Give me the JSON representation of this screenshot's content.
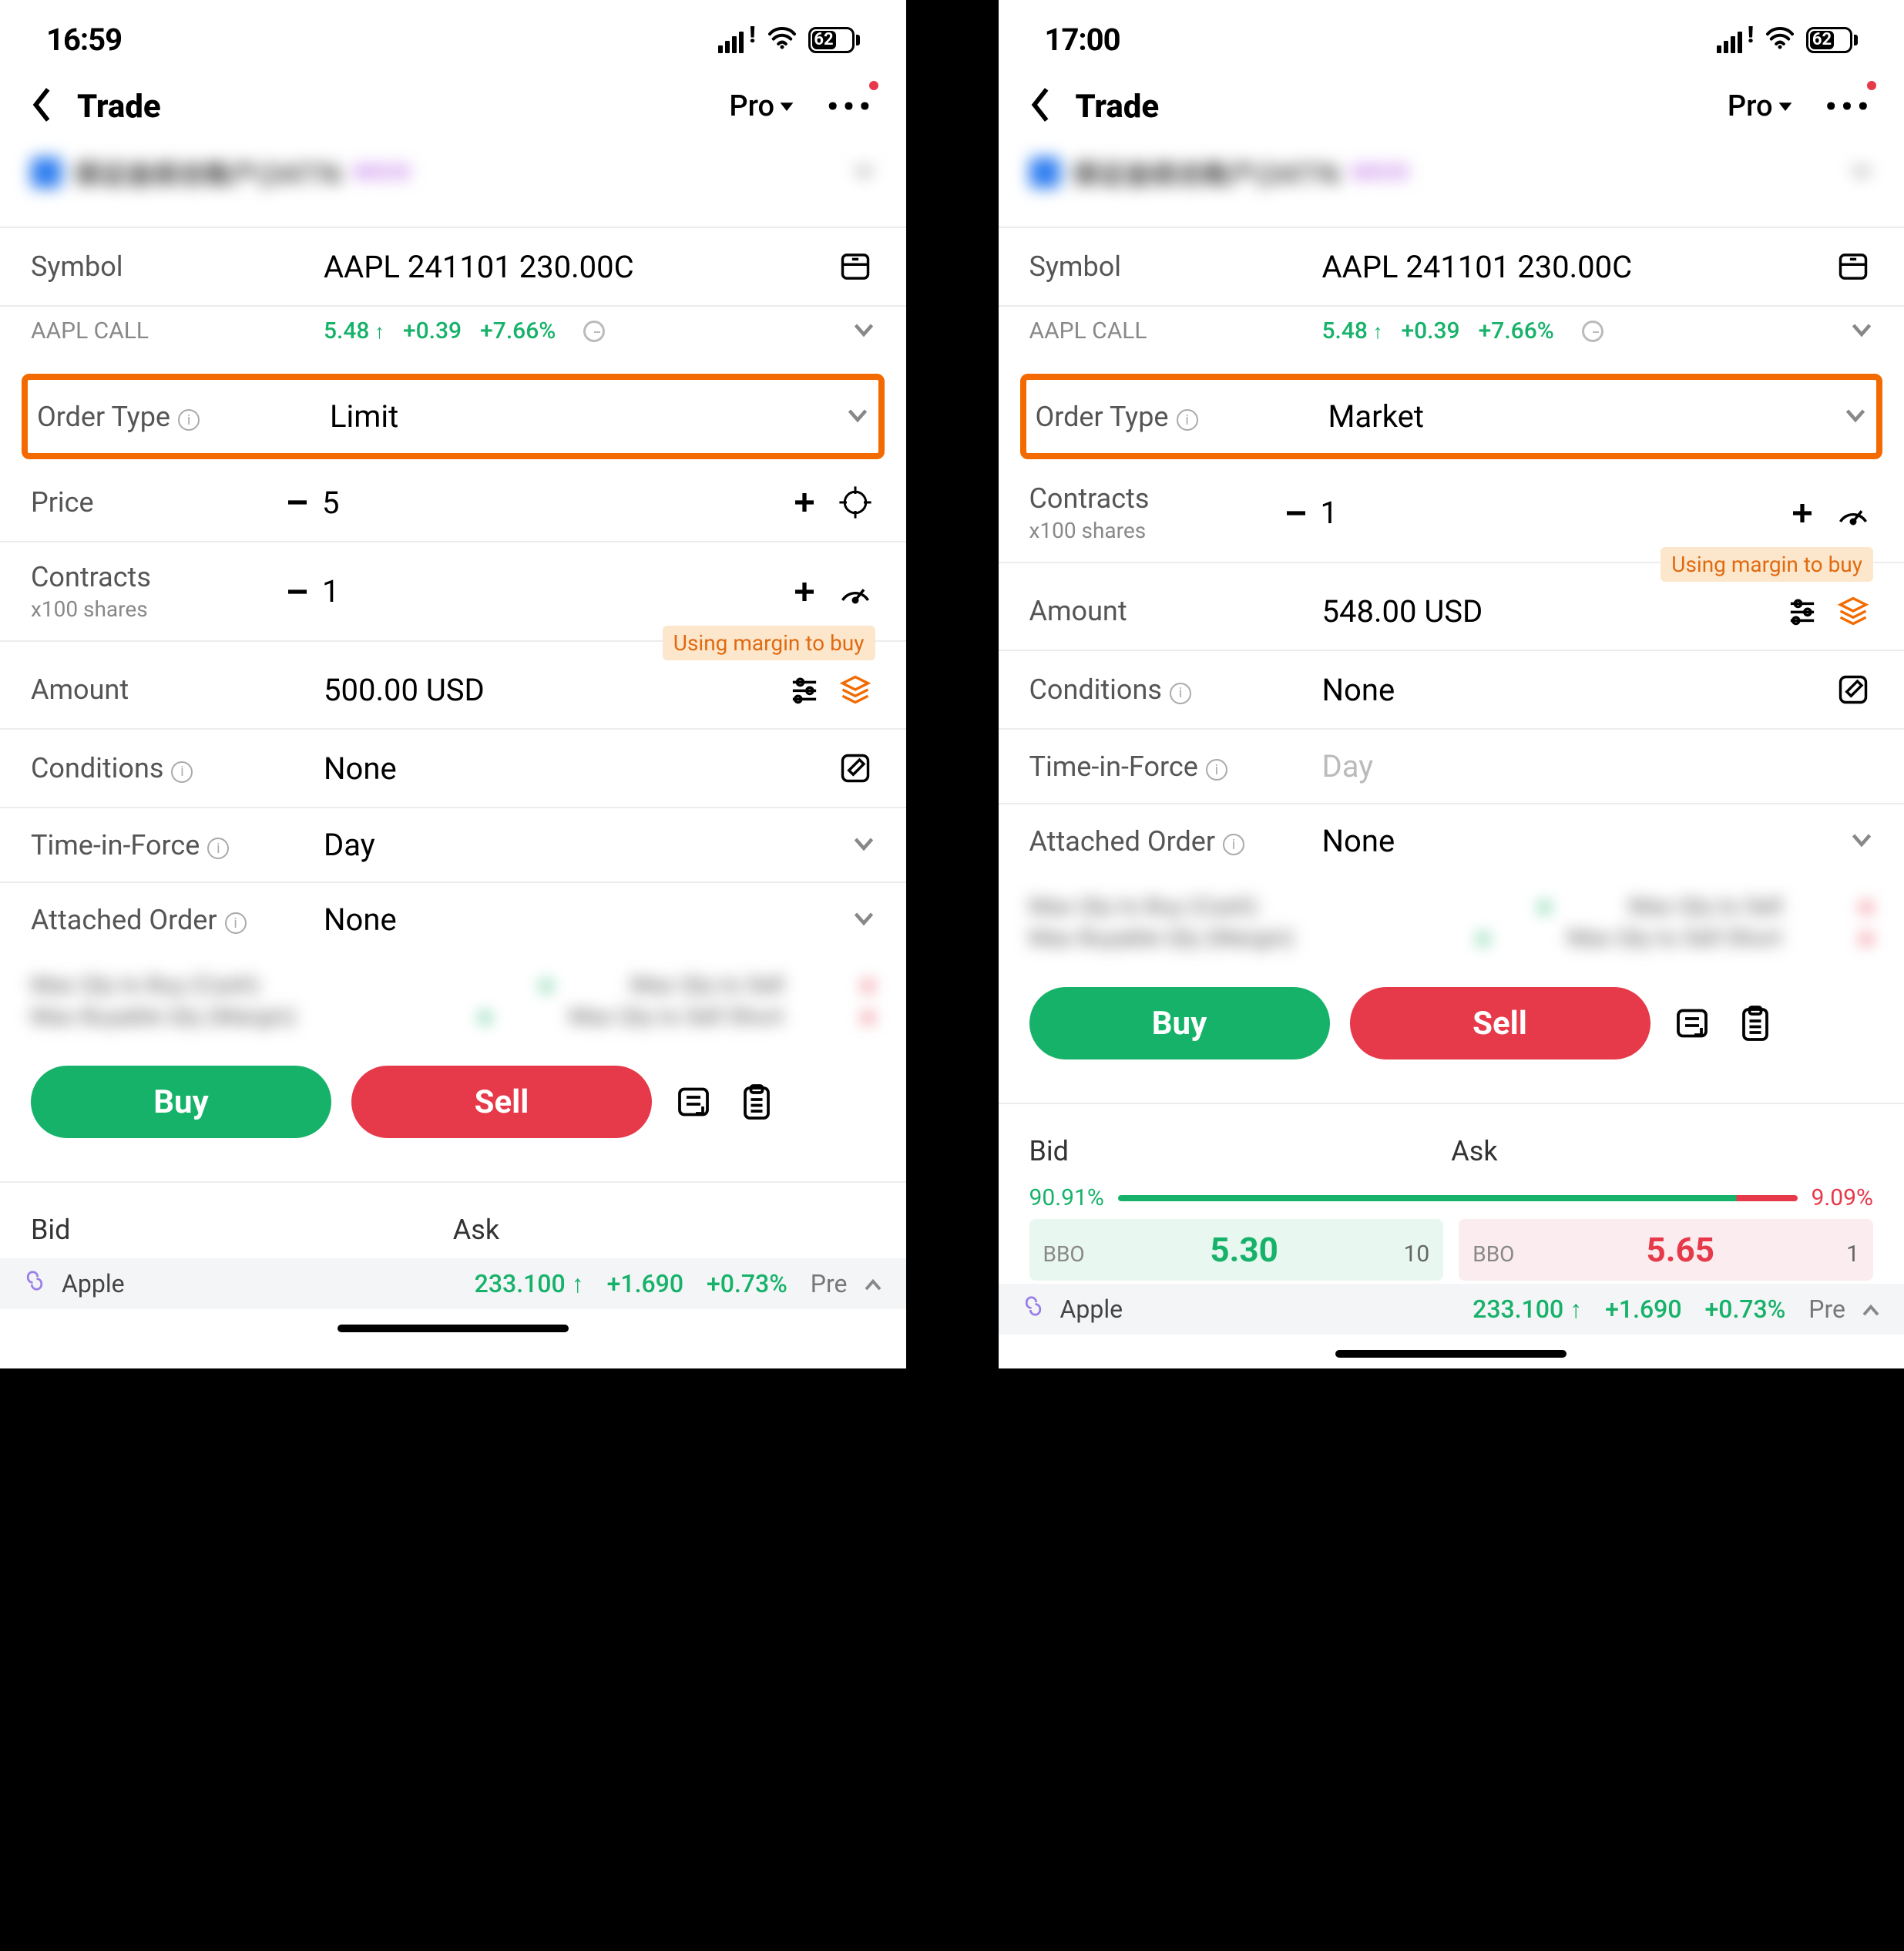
{
  "left": {
    "status_time": "16:59",
    "battery_pct": "62",
    "nav_title": "Trade",
    "pro_label": "Pro",
    "account_name": "保证金综合账户(24776",
    "account_badge": "MOCK",
    "symbol_label": "Symbol",
    "symbol_value": "AAPL 241101 230.00C",
    "quote_label": "AAPL CALL",
    "quote_price": "5.48",
    "quote_change": "+0.39",
    "quote_pct": "+7.66%",
    "order_type_label": "Order Type",
    "order_type_value": "Limit",
    "price_label": "Price",
    "price_value": "5",
    "contracts_label": "Contracts",
    "contracts_sub": "x100 shares",
    "contracts_value": "1",
    "margin_badge": "Using margin to buy",
    "amount_label": "Amount",
    "amount_value": "500.00 USD",
    "conditions_label": "Conditions",
    "conditions_value": "None",
    "tif_label": "Time-in-Force",
    "tif_value": "Day",
    "attached_label": "Attached Order",
    "attached_value": "None",
    "blur_r1a": "Max Qty to Buy (Cash)",
    "blur_r1b": "Max Qty to Sell",
    "blur_r2a": "Max Buyable Qty (Margin)",
    "blur_r2b": "Max Qty to Sell Short",
    "buy_label": "Buy",
    "sell_label": "Sell",
    "bid_label": "Bid",
    "ask_label": "Ask",
    "footer_name": "Apple",
    "footer_price": "233.100",
    "footer_change": "+1.690",
    "footer_pct": "+0.73%",
    "footer_pre": "Pre"
  },
  "right": {
    "status_time": "17:00",
    "battery_pct": "62",
    "nav_title": "Trade",
    "pro_label": "Pro",
    "account_name": "保证金综合账户(24776",
    "account_badge": "MOCK",
    "symbol_label": "Symbol",
    "symbol_value": "AAPL 241101 230.00C",
    "quote_label": "AAPL CALL",
    "quote_price": "5.48",
    "quote_change": "+0.39",
    "quote_pct": "+7.66%",
    "order_type_label": "Order Type",
    "order_type_value": "Market",
    "contracts_label": "Contracts",
    "contracts_sub": "x100 shares",
    "contracts_value": "1",
    "margin_badge": "Using margin to buy",
    "amount_label": "Amount",
    "amount_value": "548.00 USD",
    "conditions_label": "Conditions",
    "conditions_value": "None",
    "tif_label": "Time-in-Force",
    "tif_value": "Day",
    "attached_label": "Attached Order",
    "attached_value": "None",
    "blur_r1a": "Max Qty to Buy (Cash)",
    "blur_r1b": "Max Qty to Sell",
    "blur_r2a": "Max Buyable Qty (Margin)",
    "blur_r2b": "Max Qty to Sell Short",
    "buy_label": "Buy",
    "sell_label": "Sell",
    "bid_label": "Bid",
    "ask_label": "Ask",
    "bid_pct": "90.91%",
    "ask_pct": "9.09%",
    "bbo_label": "BBO",
    "bbo_bid_price": "5.30",
    "bbo_bid_qty": "10",
    "bbo_ask_price": "5.65",
    "bbo_ask_qty": "1",
    "footer_name": "Apple",
    "footer_price": "233.100",
    "footer_change": "+1.690",
    "footer_pct": "+0.73%",
    "footer_pre": "Pre"
  }
}
